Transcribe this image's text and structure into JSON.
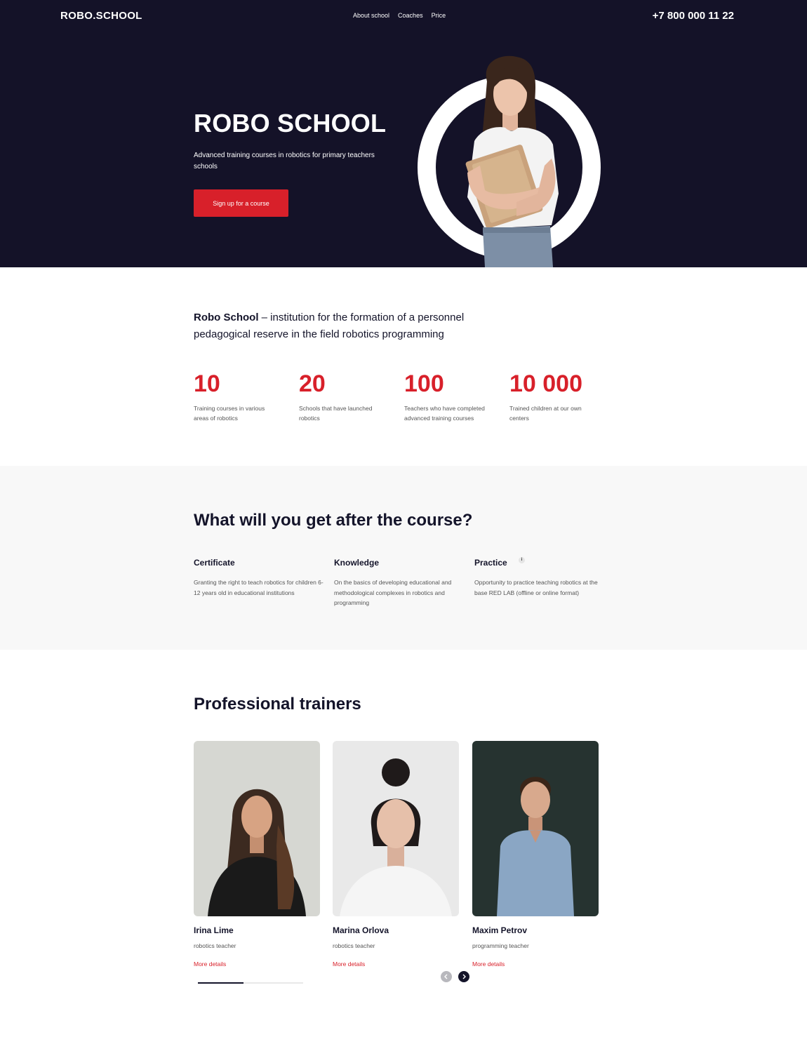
{
  "header": {
    "logo": "ROBO.SCHOOL",
    "nav": [
      "About school",
      "Coaches",
      "Price"
    ],
    "phone": "+7 800 000 11 22"
  },
  "hero": {
    "title": "ROBO SCHOOL",
    "subtitle": "Advanced training courses in robotics for primary teachers schools",
    "cta_label": "Sign up for a course"
  },
  "intro": {
    "brand": "Robo School",
    "text": " – institution for the formation of a personnel pedagogical reserve in the field robotics programming"
  },
  "stats": [
    {
      "value": "10",
      "label": "Training courses in various areas of robotics"
    },
    {
      "value": "20",
      "label": "Schools that have launched robotics"
    },
    {
      "value": "100",
      "label": "Teachers who have completed advanced training courses"
    },
    {
      "value": "10 000",
      "label": "Trained children at our own centers"
    }
  ],
  "benefits": {
    "title": "What will you get after the course?",
    "items": [
      {
        "title": "Certificate",
        "text": "Granting the right to teach robotics for children 6-12 years old in educational institutions"
      },
      {
        "title": "Knowledge",
        "text": "On the basics of developing educational and methodological complexes in robotics and programming"
      },
      {
        "title": "Practice",
        "text": "Opportunity to practice teaching robotics at the base RED LAB (offline or online format)"
      }
    ],
    "info_icon": "i"
  },
  "trainers": {
    "title": "Professional trainers",
    "items": [
      {
        "name": "Irina Lime",
        "role": "robotics teacher",
        "more": "More details"
      },
      {
        "name": "Marina Orlova",
        "role": "robotics teacher",
        "more": "More details"
      },
      {
        "name": "Maxim Petrov",
        "role": "programming teacher",
        "more": "More details"
      }
    ],
    "slider_progress": 0.43
  },
  "colors": {
    "hero_bg": "#141228",
    "accent": "#d8202a",
    "section_bg": "#f8f8f8"
  },
  "icons": [
    "info-icon",
    "arrow-left-icon",
    "arrow-right-icon"
  ]
}
